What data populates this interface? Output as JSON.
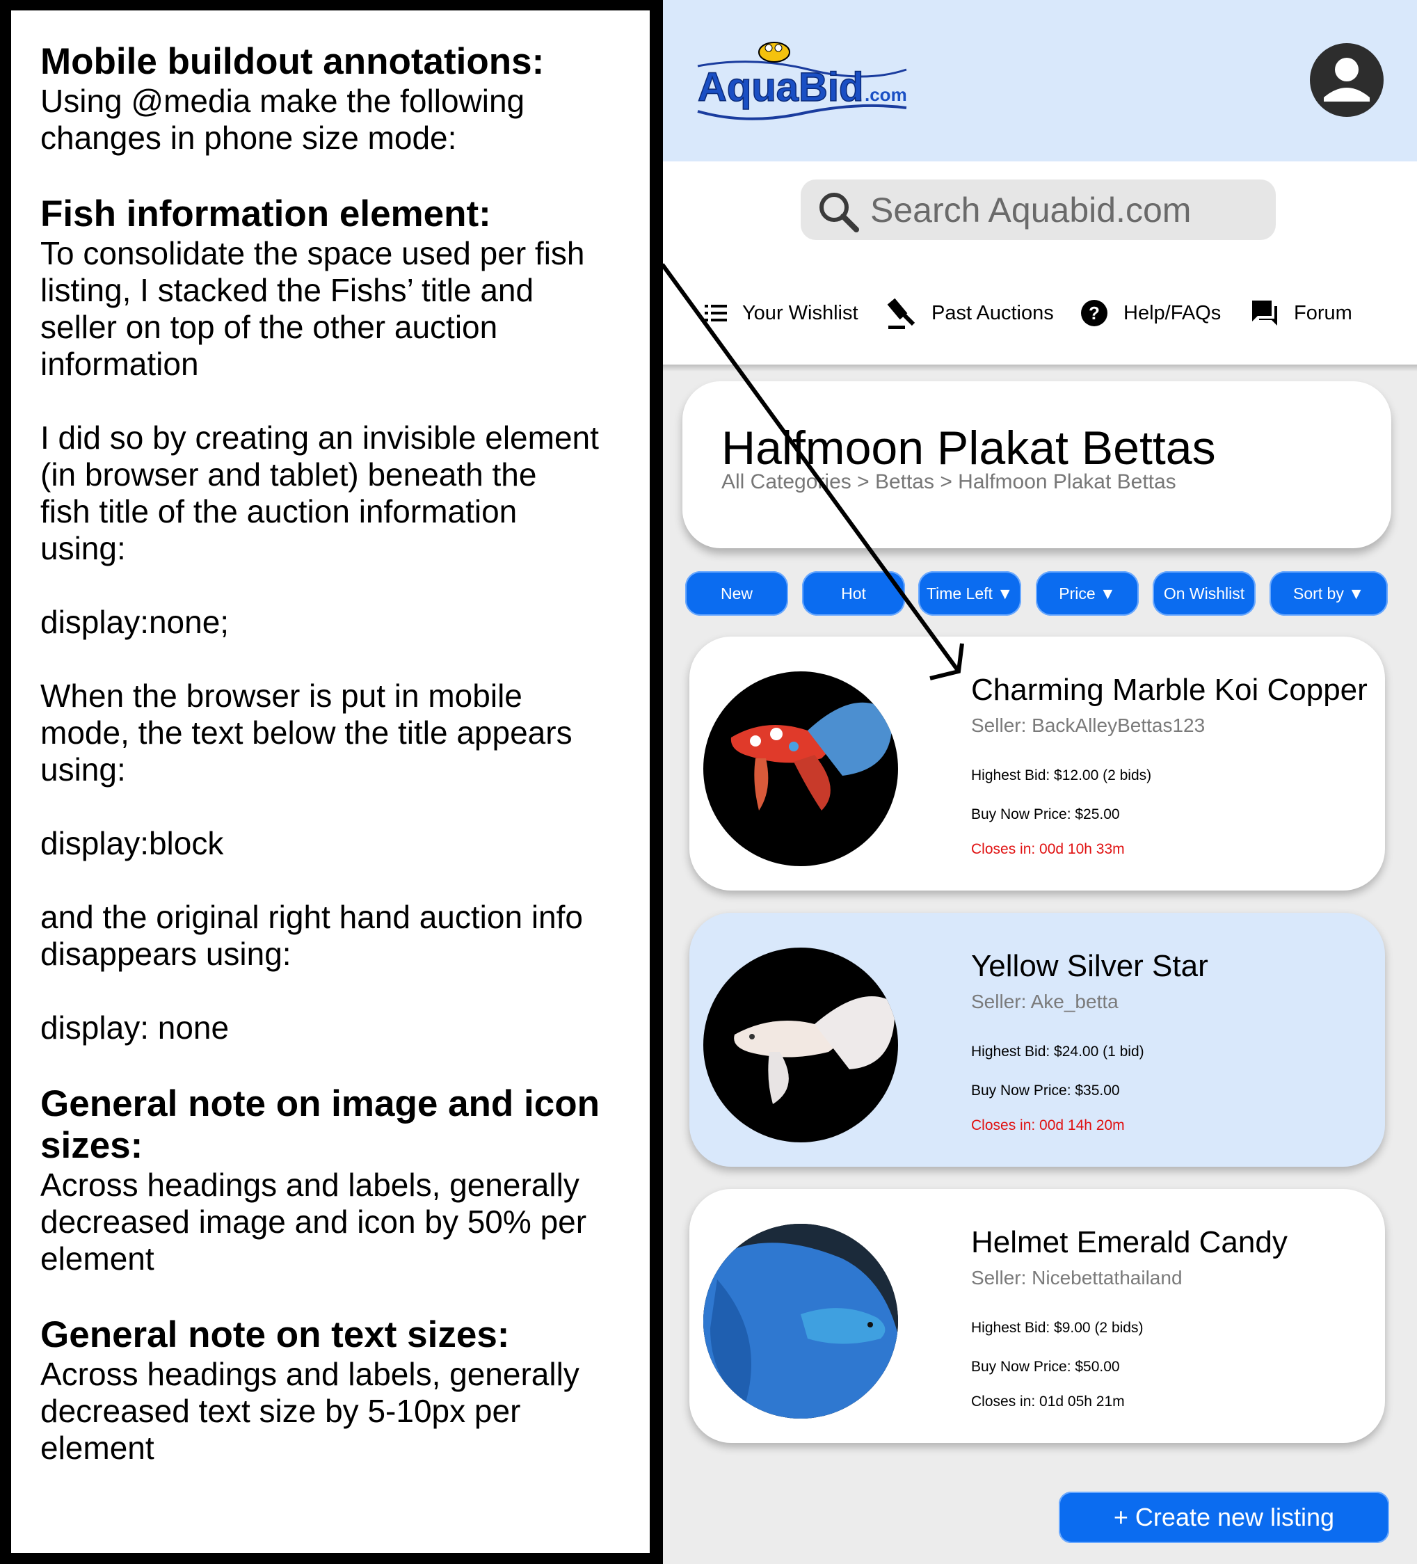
{
  "notes": {
    "heading1": "Mobile buildout annotations:",
    "intro": [
      "Using @media make the following",
      "changes in phone size mode:"
    ],
    "heading2": "Fish information element:",
    "para1": [
      "To consolidate the space used per fish",
      "listing, I stacked the Fishs’ title and",
      "seller on top of the other auction",
      "information"
    ],
    "para2": [
      "I did so by creating an invisible element",
      "(in browser and tablet) beneath the",
      "fish title of the auction information",
      "using:"
    ],
    "code1": "display:none;",
    "para3": [
      "When the browser is put in mobile",
      "mode, the text below the title appears",
      "using:"
    ],
    "code2": "display:block",
    "para4": [
      "and the original right hand auction info",
      "disappears using:"
    ],
    "code3": "display: none",
    "heading3": [
      "General note on image and icon",
      "sizes:"
    ],
    "para5": [
      "Across headings and labels, generally",
      "decreased image and icon by 50% per",
      "element"
    ],
    "heading4": "General note on text sizes:",
    "para6": [
      "Across headings and labels, generally",
      "decreased text size by 5-10px per",
      "element"
    ]
  },
  "header": {
    "logo_main": "AquaBid",
    "logo_suffix": ".com",
    "search_placeholder": "Search Aquabid.com"
  },
  "nav": [
    {
      "label": "Your Wishlist",
      "icon": "list-icon"
    },
    {
      "label": "Past Auctions",
      "icon": "gavel-icon"
    },
    {
      "label": "Help/FAQs",
      "icon": "help-icon"
    },
    {
      "label": "Forum",
      "icon": "chat-icon"
    }
  ],
  "category": {
    "title": "Halfmoon Plakat Bettas",
    "breadcrumb": "All Categories > Bettas > Halfmoon Plakat Bettas"
  },
  "filters": [
    "New",
    "Hot",
    "Time Left",
    "Price",
    "On Wishlist",
    "Sort by"
  ],
  "listings": [
    {
      "name": "Charming Marble Koi Copper",
      "seller": "Seller: BackAlleyBettas123",
      "highest_bid": "Highest Bid: $12.00 (2 bids)",
      "buy_now": "Buy Now Price: $25.00",
      "closes": "Closes in: 00d 10h 33m",
      "bg": "#ffffff",
      "close_color": "#e01010"
    },
    {
      "name": "Yellow Silver Star",
      "seller": "Seller: Ake_betta",
      "highest_bid": "Highest Bid: $24.00 (1 bid)",
      "buy_now": "Buy Now Price: $35.00",
      "closes": "Closes in: 00d 14h 20m",
      "bg": "#d9e8fb",
      "close_color": "#e01010"
    },
    {
      "name": "Helmet Emerald Candy",
      "seller": "Seller: Nicebettathailand",
      "highest_bid": "Highest Bid: $9.00 (2 bids)",
      "buy_now": "Buy Now Price: $50.00",
      "closes": "Closes in: 01d 05h 21m",
      "bg": "#ffffff",
      "close_color": "#000000"
    }
  ],
  "create_button": "+ Create new listing",
  "colors": {
    "accent": "#0b6cf0",
    "header_bg": "#d9e8fb",
    "closing_red": "#e01010"
  }
}
